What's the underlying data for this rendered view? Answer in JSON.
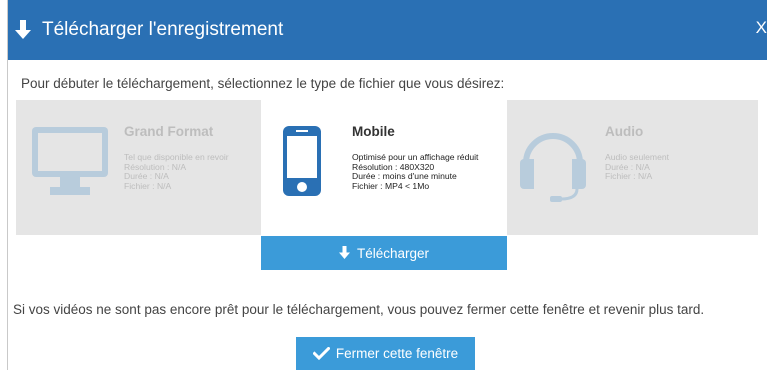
{
  "dialog": {
    "title": "Télécharger l'enregistrement",
    "close_label": "X",
    "intro": "Pour débuter le téléchargement, sélectionnez le type de fichier que vous désirez:",
    "note": "Si vos vidéos ne sont pas encore prêt pour le téléchargement, vous pouvez fermer cette fenêtre et revenir plus tard.",
    "download_label": "Télécharger",
    "close_window_label": "Fermer cette fenêtre"
  },
  "options": [
    {
      "name": "Grand Format",
      "lines": [
        "Tel que disponible en revoir",
        "Résolution : N/A",
        "Durée : N/A",
        "Fichier :  N/A"
      ],
      "icon": "monitor-icon",
      "selected": false
    },
    {
      "name": "Mobile",
      "lines": [
        "Optimisé pour un affichage réduit",
        "Résolution : 480X320",
        "Durée : moins d'une minute",
        "Fichier :  MP4 < 1Mo"
      ],
      "icon": "smartphone-icon",
      "selected": true
    },
    {
      "name": "Audio",
      "lines": [
        "Audio seulement",
        "Durée : N/A",
        "Fichier :  N/A"
      ],
      "icon": "headset-icon",
      "selected": false
    }
  ],
  "colors": {
    "header": "#2a70b4",
    "button": "#3b9bd9",
    "selected_icon": "#2a70b4",
    "inactive_icon": "#b8ccdc"
  }
}
